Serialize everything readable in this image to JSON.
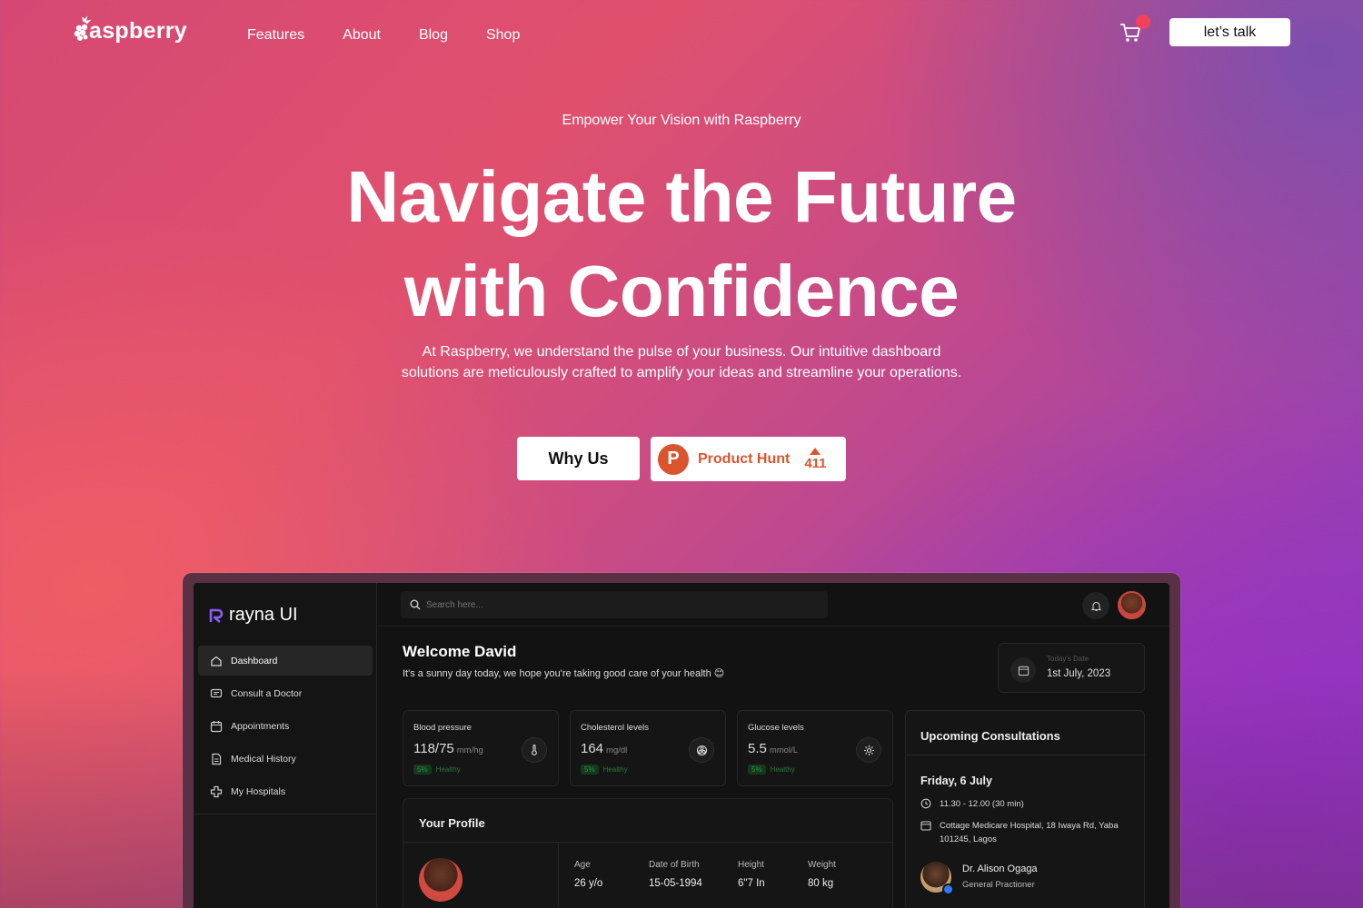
{
  "brand": {
    "name": "aspberry",
    "logo_letter": "R"
  },
  "nav": {
    "links": [
      "Features",
      "About",
      "Blog",
      "Shop"
    ],
    "cta": "let’s talk"
  },
  "hero": {
    "eyebrow": "Empower Your Vision with Raspberry",
    "headline": [
      "Navigate the Future",
      "with Confidence"
    ],
    "subtext": [
      "At Raspberry, we understand the pulse of your business. Our intuitive dashboard",
      "solutions are meticulously crafted to amplify your ideas and streamline your operations."
    ],
    "primary_button": "Why Us",
    "product_hunt": {
      "letter": "P",
      "label": "Product Hunt",
      "votes": "411"
    }
  },
  "dashboard": {
    "app_name": "rayna UI",
    "sidebar": [
      {
        "label": "Dashboard",
        "icon": "home-icon"
      },
      {
        "label": "Consult a Doctor",
        "icon": "chat-icon"
      },
      {
        "label": "Appointments",
        "icon": "calendar-icon"
      },
      {
        "label": "Medical History",
        "icon": "document-icon"
      },
      {
        "label": "My Hospitals",
        "icon": "hospital-cross-icon"
      }
    ],
    "search_placeholder": "Search here...",
    "welcome_title": "Welcome David",
    "welcome_sub": "It's a sunny day today, we hope you're taking good care of your health 😊",
    "date_label": "Today's Date",
    "date_value": "1st July, 2023",
    "metrics": [
      {
        "title": "Blood pressure",
        "value": "118/75",
        "unit": "mm/hg",
        "pct": "5%",
        "status": "Healthy",
        "icon": "thermometer-icon"
      },
      {
        "title": "Cholesterol levels",
        "value": "164",
        "unit": "mg/dl",
        "pct": "5%",
        "status": "Healthy",
        "icon": "cells-icon"
      },
      {
        "title": "Glucose levels",
        "value": "5.5",
        "unit": "mmol/L",
        "pct": "5%",
        "status": "Healthy",
        "icon": "gear-icon"
      }
    ],
    "profile": {
      "title": "Your Profile",
      "fields": [
        {
          "label": "Age",
          "value": "26 y/o"
        },
        {
          "label": "Date of Birth",
          "value": "15-05-1994"
        },
        {
          "label": "Height",
          "value": "6\"7 In"
        },
        {
          "label": "Weight",
          "value": "80 kg"
        }
      ]
    },
    "consultations": {
      "title": "Upcoming Consultations",
      "day": "Friday, 6 July",
      "time": "11.30 - 12.00 (30 min)",
      "location": "Cottage Medicare Hospital, 18 Iwaya Rd, Yaba 101245, Lagos",
      "doctor_name": "Dr. Alison Ogaga",
      "doctor_role": "General Practioner"
    }
  },
  "colors": {
    "accent_red": "#f0435a",
    "product_hunt": "#da552f",
    "dashboard_bg": "#121212",
    "healthy_green": "#2f8f45"
  }
}
